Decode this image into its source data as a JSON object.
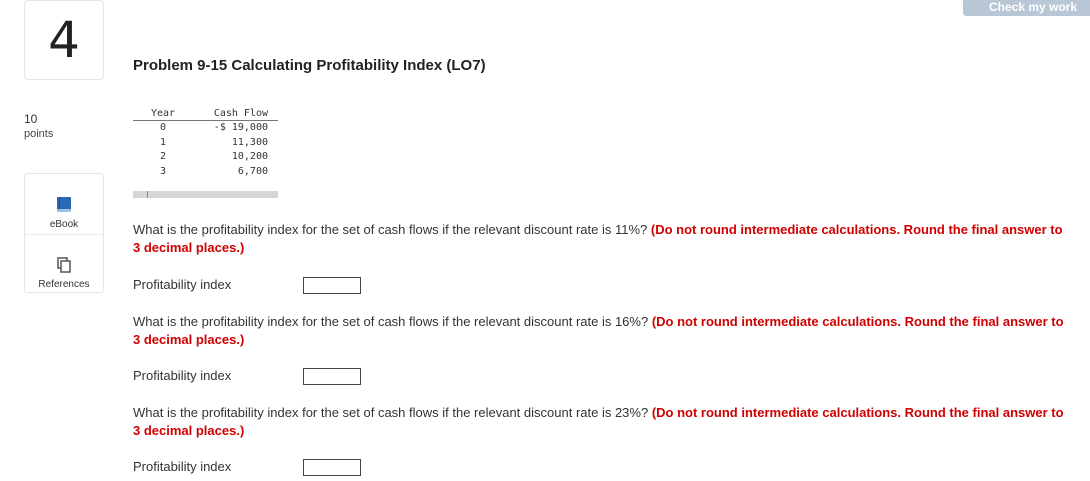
{
  "question_number": "4",
  "check_button": "Check my work",
  "points": {
    "value": "10",
    "label": "points"
  },
  "sidebar": {
    "ebook_label": "eBook",
    "references_label": "References"
  },
  "title": "Problem 9-15 Calculating Profitability Index (LO7)",
  "table": {
    "headers": [
      "Year",
      "Cash Flow"
    ],
    "rows": [
      [
        "0",
        "-$ 19,000"
      ],
      [
        "1",
        "11,300"
      ],
      [
        "2",
        "10,200"
      ],
      [
        "3",
        "6,700"
      ]
    ]
  },
  "questions": [
    {
      "text": "What is the profitability index for the set of cash flows if the relevant discount rate is 11%?",
      "emphasis": "(Do not round intermediate calculations. Round the final answer to 3 decimal places.)",
      "answer_label": "Profitability index",
      "answer_value": ""
    },
    {
      "text": "What is the profitability index for the set of cash flows if the relevant discount rate is 16%?",
      "emphasis": "(Do not round intermediate calculations. Round the final answer to 3 decimal places.)",
      "answer_label": "Profitability index",
      "answer_value": ""
    },
    {
      "text": "What is the profitability index for the set of cash flows if the relevant discount rate is 23%?",
      "emphasis": "(Do not round intermediate calculations. Round the final answer to 3 decimal places.)",
      "answer_label": "Profitability index",
      "answer_value": ""
    }
  ],
  "colors": {
    "emphasis": "#d00000",
    "button": "#b9c6d6",
    "ebook_icon": "#2a6ab5"
  }
}
